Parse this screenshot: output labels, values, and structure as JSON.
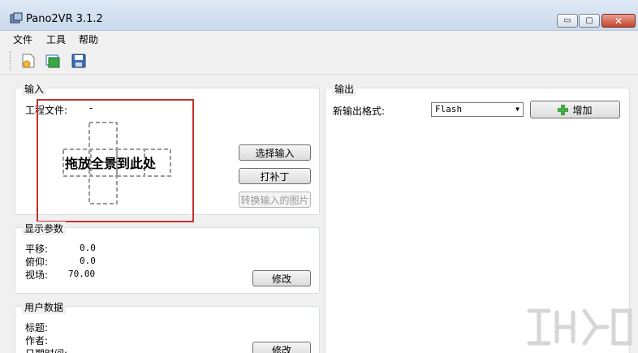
{
  "window": {
    "title": "Pano2VR 3.1.2",
    "controls": {
      "minimize": "▭",
      "maximize": "▢",
      "close": "✕"
    }
  },
  "menu": {
    "items": [
      "文件",
      "工具",
      "帮助"
    ]
  },
  "toolbar": {
    "tools": [
      "new-project-icon",
      "open-project-icon",
      "save-project-icon"
    ]
  },
  "input_panel": {
    "title": "输入",
    "project_label": "工程文件:",
    "project_value": "-",
    "drop_text": "拖放全景到此处",
    "buttons": {
      "select_input": "选择输入",
      "patch": "打补丁",
      "convert": "转换输入的图片"
    }
  },
  "display_params": {
    "title": "显示参数",
    "pan_label": "平移:",
    "pan_value": "0.0",
    "tilt_label": "俯仰:",
    "tilt_value": "0.0",
    "fov_label": "视场:",
    "fov_value": "70.00",
    "modify": "修改"
  },
  "user_data": {
    "title": "用户数据",
    "title_label": "标题:",
    "author_label": "作者:",
    "date_label": "日期时间:",
    "modify": "修改"
  },
  "output_panel": {
    "title": "输出",
    "format_label": "新输出格式:",
    "format_value": "Flash",
    "add_button": "增加"
  },
  "colors": {
    "dropzone_border": "#c8312b",
    "add_icon": "#3fb23f",
    "close_button": "#c6452f"
  }
}
